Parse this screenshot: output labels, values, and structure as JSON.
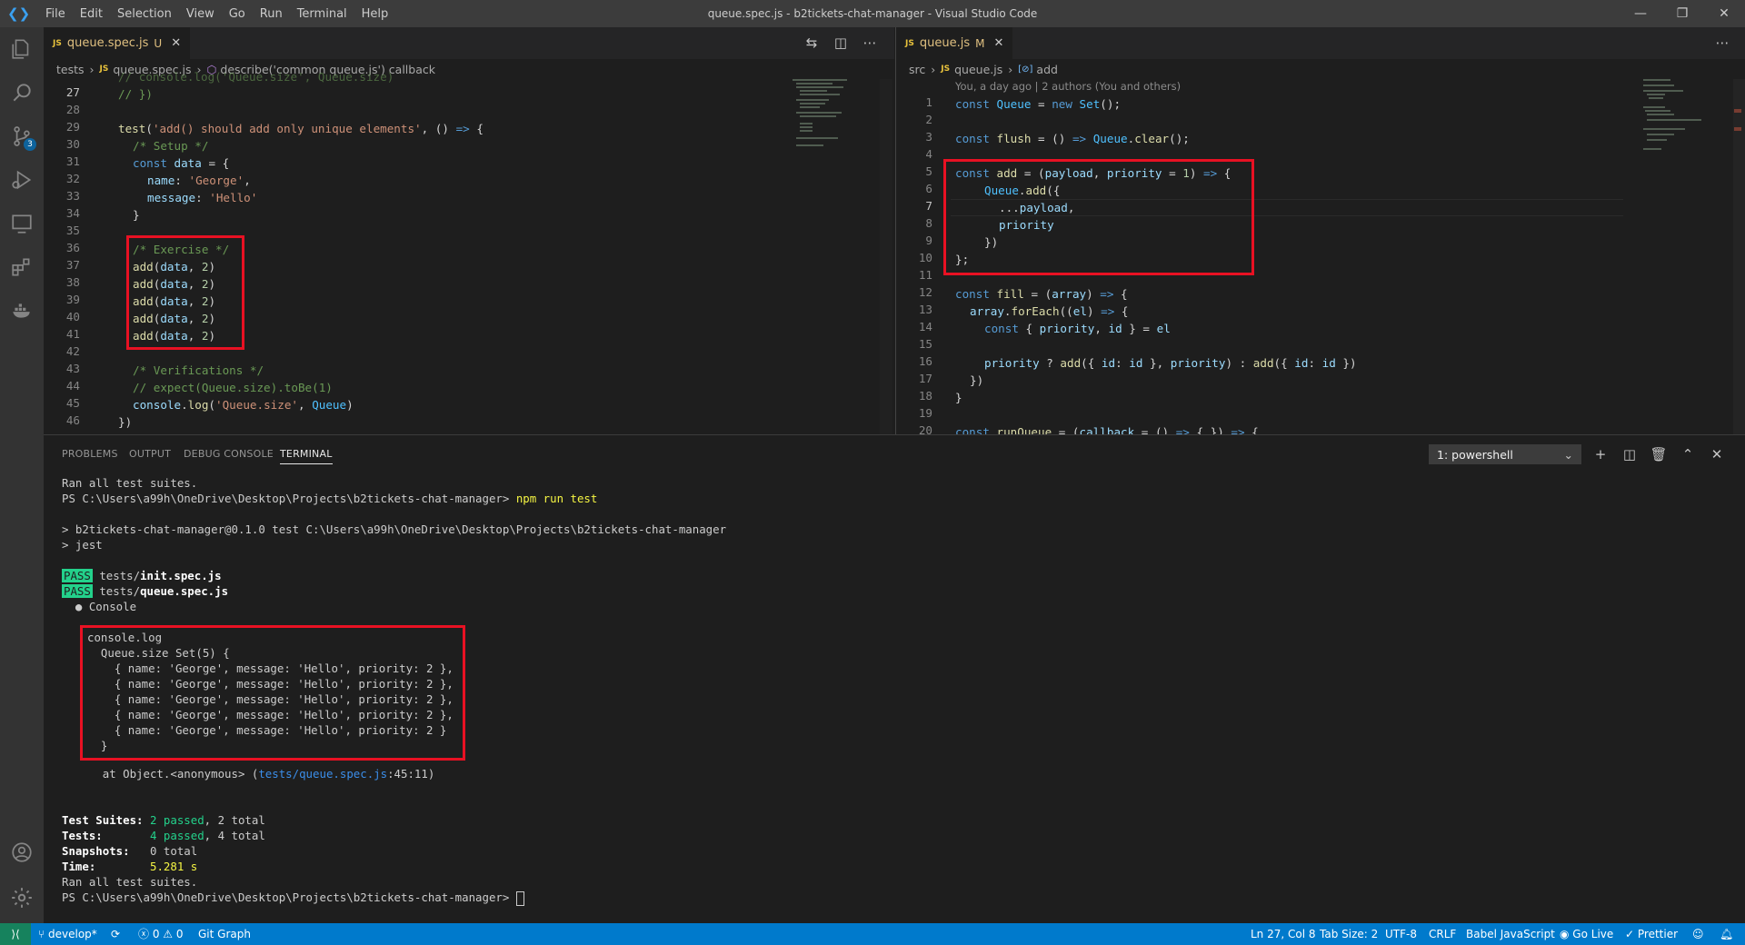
{
  "window": {
    "title": "queue.spec.js - b2tickets-chat-manager - Visual Studio Code",
    "menu": [
      "File",
      "Edit",
      "Selection",
      "View",
      "Go",
      "Run",
      "Terminal",
      "Help"
    ]
  },
  "activity": {
    "scm_badge": "3"
  },
  "left_editor": {
    "tab": {
      "icon": "JS",
      "name": "queue.spec.js",
      "flag": "U"
    },
    "breadcrumb": [
      "tests",
      "queue.spec.js",
      "describe('common queue.js') callback"
    ],
    "line_numbers": [
      "27",
      "28",
      "29",
      "30",
      "31",
      "32",
      "33",
      "34",
      "35",
      "36",
      "37",
      "38",
      "39",
      "40",
      "41",
      "42",
      "43",
      "44",
      "45",
      "46"
    ]
  },
  "right_editor": {
    "tab": {
      "icon": "JS",
      "name": "queue.js",
      "flag": "M"
    },
    "breadcrumb": [
      "src",
      "queue.js",
      "add"
    ],
    "blame": "You, a day ago | 2 authors (You and others)",
    "line_numbers": [
      "1",
      "2",
      "3",
      "4",
      "5",
      "6",
      "7",
      "8",
      "9",
      "10",
      "11",
      "12",
      "13",
      "14",
      "15",
      "16",
      "17",
      "18",
      "19",
      "20"
    ]
  },
  "panel": {
    "tabs": [
      "PROBLEMS",
      "OUTPUT",
      "DEBUG CONSOLE",
      "TERMINAL"
    ],
    "active_tab": "TERMINAL",
    "terminal_select": "1: powershell",
    "lines": {
      "l1": "Ran all test suites.",
      "l2_prompt": "PS C:\\Users\\a99h\\OneDrive\\Desktop\\Projects\\b2tickets-chat-manager> ",
      "l2_cmd": "npm run test",
      "l3": "> b2tickets-chat-manager@0.1.0 test C:\\Users\\a99h\\OneDrive\\Desktop\\Projects\\b2tickets-chat-manager",
      "l4": "> jest",
      "pass": "PASS",
      "t1_dir": "tests/",
      "t1_file": "init.spec.js",
      "t2_dir": "tests/",
      "t2_file": "queue.spec.js",
      "console_bullet": "  ● Console",
      "log1": "console.log",
      "log2": "  Queue.size Set(5) {",
      "log3": "    { name: 'George', message: 'Hello', priority: 2 },",
      "log4": "    { name: 'George', message: 'Hello', priority: 2 },",
      "log5": "    { name: 'George', message: 'Hello', priority: 2 },",
      "log6": "    { name: 'George', message: 'Hello', priority: 2 },",
      "log7": "    { name: 'George', message: 'Hello', priority: 2 }",
      "log8": "  }",
      "at_prefix": "      at Object.<anonymous> (",
      "at_link": "tests/queue.spec.js",
      "at_suffix": ":45:11)",
      "suites_label": "Test Suites: ",
      "suites_pass": "2 passed",
      "suites_total": ", 2 total",
      "tests_label": "Tests:       ",
      "tests_pass": "4 passed",
      "tests_total": ", 4 total",
      "snap_label": "Snapshots:   ",
      "snap_total": "0 total",
      "time_label": "Time:        ",
      "time_val": "5.281 s",
      "ran": "Ran all test suites.",
      "final_prompt": "PS C:\\Users\\a99h\\OneDrive\\Desktop\\Projects\\b2tickets-chat-manager> "
    }
  },
  "statusbar": {
    "branch": "develop*",
    "errors": "0",
    "warnings": "0",
    "git_graph": "Git Graph",
    "position": "Ln 27, Col 8",
    "tab_size": "Tab Size: 2",
    "encoding": "UTF-8",
    "eol": "CRLF",
    "language": "Babel JavaScript",
    "golive": "Go Live",
    "prettier": "Prettier"
  },
  "colors": {
    "statusbar": "#007acc",
    "highlight_box": "#e81123",
    "pass_badge": "#23d18b"
  }
}
